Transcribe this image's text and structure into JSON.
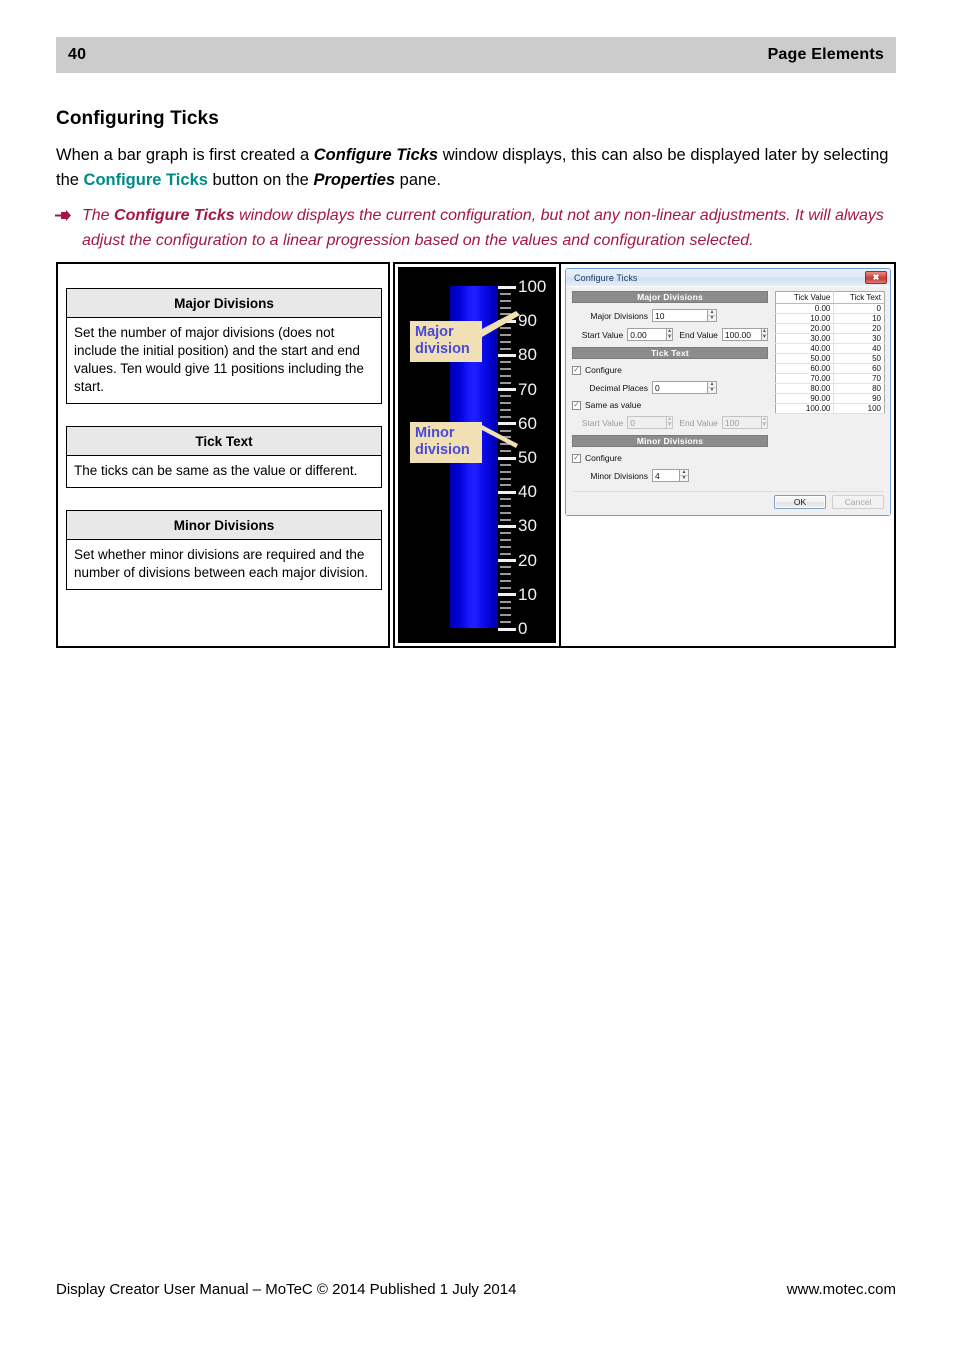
{
  "header": {
    "page_number": "40",
    "section_title": "Page Elements"
  },
  "heading": "Configuring Ticks",
  "paragraph": {
    "part1": "When a bar graph is first created a ",
    "bold1": "Configure Ticks",
    "part2": " window displays, this can also be displayed later by selecting the ",
    "link": "Configure Ticks",
    "part3": " button on the ",
    "bold2": "Properties",
    "part4": " pane."
  },
  "note": {
    "marker": "➜",
    "part1": "The ",
    "bold1": "Configure Ticks",
    "part2": " window displays the current configuration, but not any non-linear adjustments. It will always adjust the configuration to a linear progression based on the values and configuration selected."
  },
  "tables": [
    {
      "title": "Major Divisions",
      "body": "Set the number of major divisions (does not include the initial position) and the start and end values. Ten would give 11 positions including the start."
    },
    {
      "title": "Tick Text",
      "body": "The ticks can be same as the value or different."
    },
    {
      "title": "Minor Divisions",
      "body": "Set whether minor divisions are required and the number of divisions between each major division."
    }
  ],
  "bargraph": {
    "tick_labels": [
      "100",
      "90",
      "80",
      "70",
      "60",
      "50",
      "40",
      "30",
      "20",
      "10",
      "0"
    ],
    "minor_divisions": 4,
    "callout_major": "Major division",
    "callout_minor": "Minor division",
    "background_color": "#000000",
    "bar_color": "#1b1bff",
    "callout_bg": "#f0e0b4",
    "callout_fg": "#4a4ad8"
  },
  "dialog": {
    "title": "Configure Ticks",
    "close_label": "✖",
    "section_major": "Major Divisions",
    "section_ticktext": "Tick Text",
    "section_minor": "Minor Divisions",
    "major_divisions_label": "Major Divisions",
    "major_divisions_value": "10",
    "start_value_label": "Start Value",
    "start_value": "0.00",
    "end_value_label": "End Value",
    "end_value": "100.00",
    "ticktext_configure_label": "Configure",
    "ticktext_configure_checked": "✓",
    "decimal_places_label": "Decimal Places",
    "decimal_places_value": "0",
    "same_as_value_label": "Same as value",
    "same_as_value_checked": "✓",
    "tt_start_label": "Start Value",
    "tt_start_value": "0",
    "tt_end_label": "End Value",
    "tt_end_value": "100",
    "minor_configure_label": "Configure",
    "minor_configure_checked": "✓",
    "minor_divisions_label": "Minor Divisions",
    "minor_divisions_value": "4",
    "ok_label": "OK",
    "cancel_label": "Cancel",
    "table": {
      "col1": "Tick Value",
      "col2": "Tick Text",
      "rows": [
        [
          "0.00",
          "0"
        ],
        [
          "10.00",
          "10"
        ],
        [
          "20.00",
          "20"
        ],
        [
          "30.00",
          "30"
        ],
        [
          "40.00",
          "40"
        ],
        [
          "50.00",
          "50"
        ],
        [
          "60.00",
          "60"
        ],
        [
          "70.00",
          "70"
        ],
        [
          "80.00",
          "80"
        ],
        [
          "90.00",
          "90"
        ],
        [
          "100.00",
          "100"
        ]
      ]
    }
  },
  "footer": {
    "left": "Display Creator User Manual – MoTeC © 2014 Published 1 July 2014",
    "right": "www.motec.com"
  }
}
